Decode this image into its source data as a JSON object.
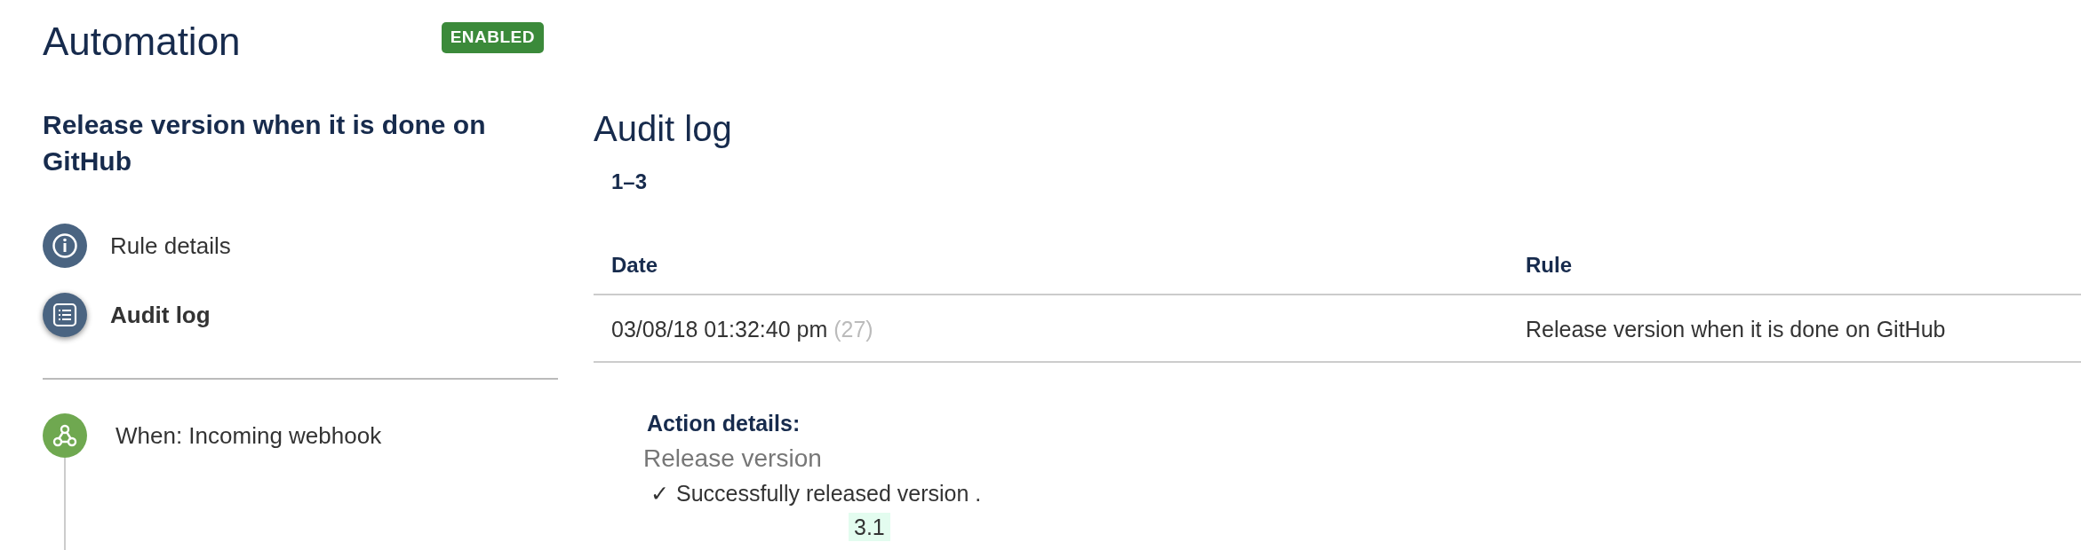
{
  "header": {
    "title": "Automation",
    "status_badge": "ENABLED"
  },
  "sidebar": {
    "rule_name": "Release version when it is done on GitHub",
    "items": [
      {
        "kind": "info",
        "label": "Rule details",
        "selected": false
      },
      {
        "kind": "list",
        "label": "Audit log",
        "selected": true
      }
    ],
    "trigger": {
      "label": "When: Incoming webhook"
    }
  },
  "audit_log": {
    "title": "Audit log",
    "range": "1–3",
    "table": {
      "columns": [
        "Date",
        "Rule"
      ],
      "rows": [
        {
          "date": "03/08/18 01:32:40 pm",
          "count": "(27)",
          "rule": "Release version when it is done on GitHub"
        }
      ]
    },
    "details": {
      "heading": "Action details:",
      "action": "Release version",
      "check": "✓",
      "message": "Successfully released version .",
      "version": "3.1"
    }
  }
}
